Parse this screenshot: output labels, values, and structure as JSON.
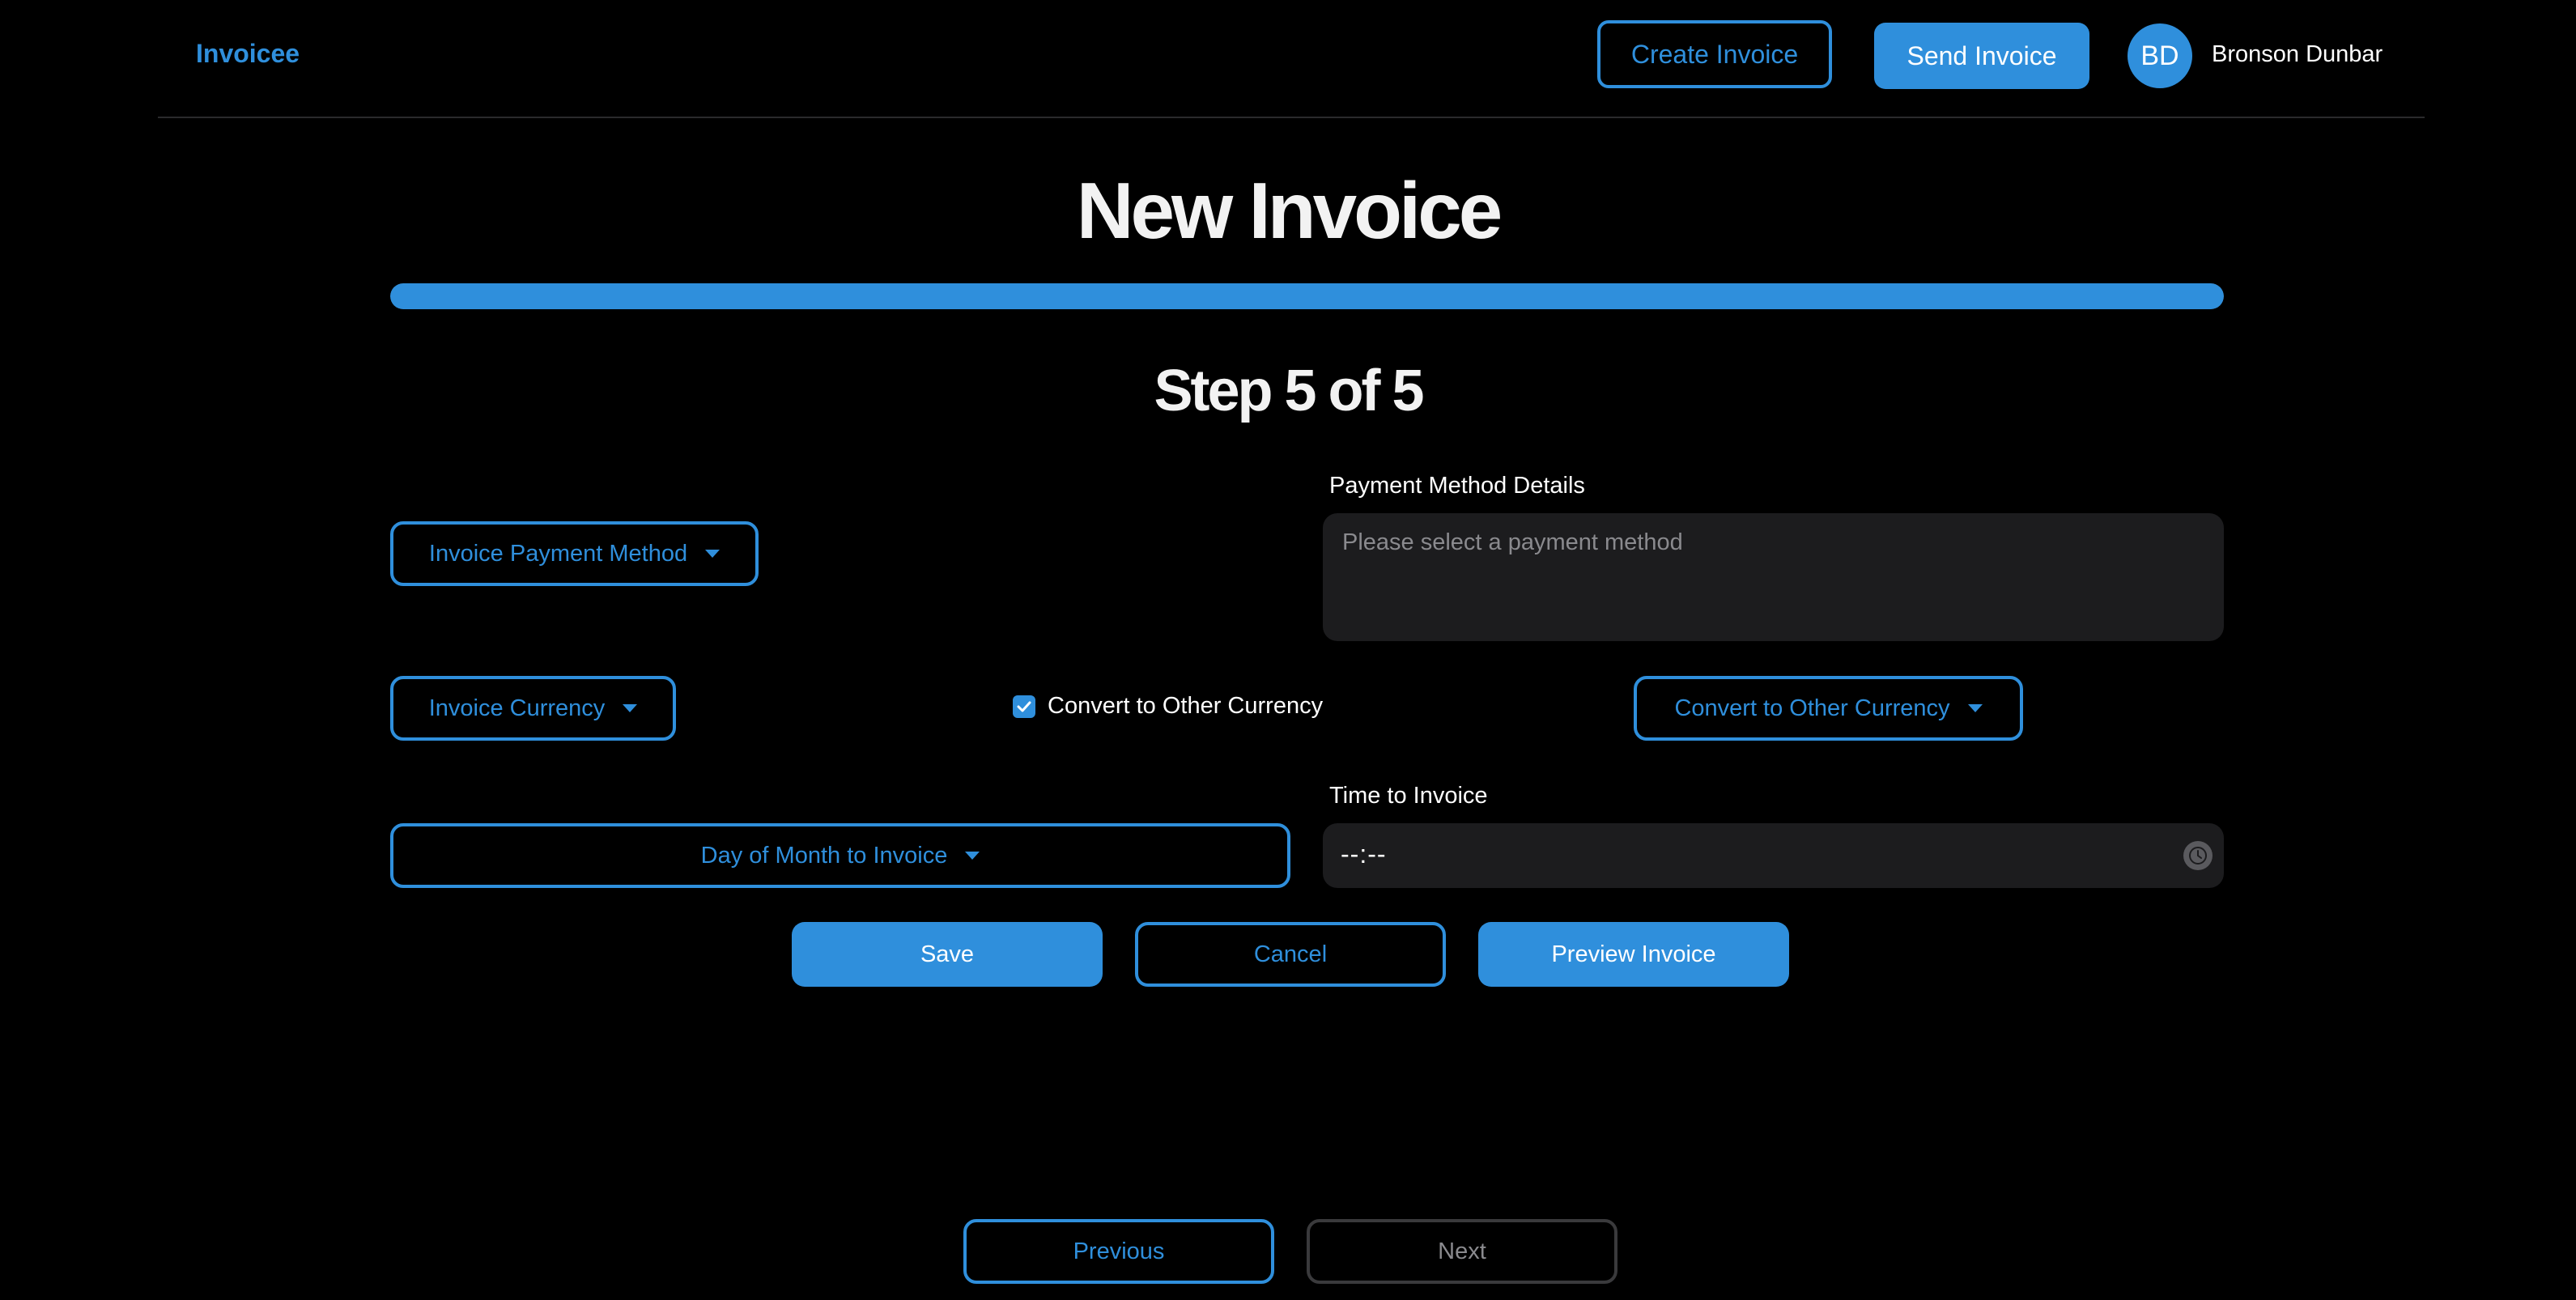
{
  "navbar": {
    "brand": "Invoicee",
    "create_invoice_label": "Create Invoice",
    "send_invoice_label": "Send Invoice",
    "avatar_initials": "BD",
    "user_name": "Bronson Dunbar"
  },
  "page": {
    "title": "New Invoice",
    "progress_fraction": 1.0,
    "step_label": "Step 5 of 5"
  },
  "form": {
    "payment_method_dropdown": "Invoice Payment Method",
    "payment_method_details_label": "Payment Method Details",
    "payment_method_details_placeholder": "Please select a payment method",
    "currency_dropdown": "Invoice Currency",
    "convert_checkbox_label": "Convert to Other Currency",
    "convert_checkbox_checked": true,
    "convert_currency_dropdown": "Convert to Other Currency",
    "day_of_month_dropdown": "Day of Month to Invoice",
    "time_label": "Time to Invoice",
    "time_value": "--:--"
  },
  "actions": {
    "save_label": "Save",
    "cancel_label": "Cancel",
    "preview_label": "Preview Invoice"
  },
  "pager": {
    "previous_label": "Previous",
    "next_label": "Next",
    "next_disabled": true
  },
  "colors": {
    "accent": "#2f8fdc",
    "background": "#000000",
    "field_background": "#1c1c1e"
  },
  "icons": {
    "dropdown": "caret-down-icon",
    "checkbox": "check-icon",
    "time_picker": "clock-icon"
  }
}
